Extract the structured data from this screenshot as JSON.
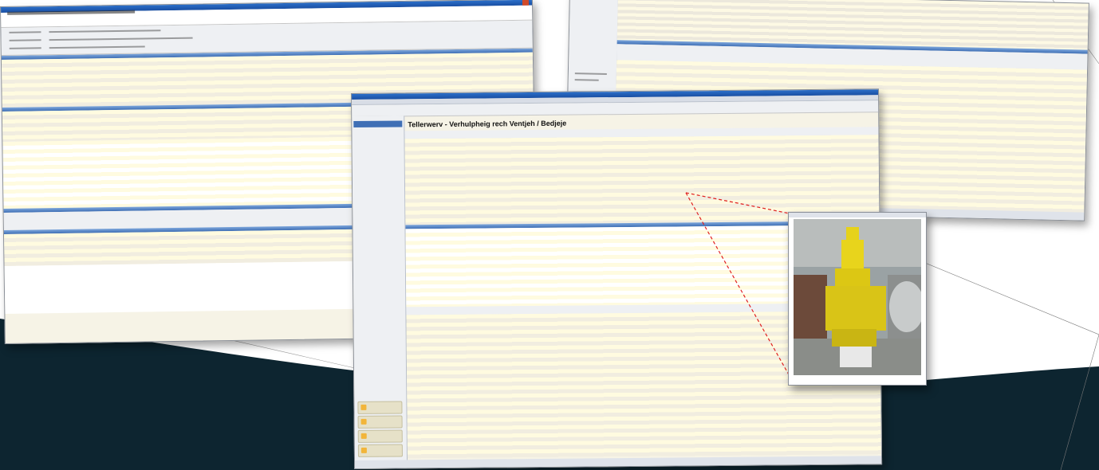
{
  "colors": {
    "dark_background": "#0d2530",
    "window_title": "#1a4fa3",
    "row_yellow": "#fffbe0",
    "callout_line": "#e02020"
  },
  "center_window": {
    "title": "Tellerwerv - Verhulpheig rech Ventjeh / Bedjeje"
  },
  "photo": {
    "subject": "yellow safety valve"
  },
  "icons": [
    "logo-icon",
    "close-icon",
    "folder-icon"
  ]
}
